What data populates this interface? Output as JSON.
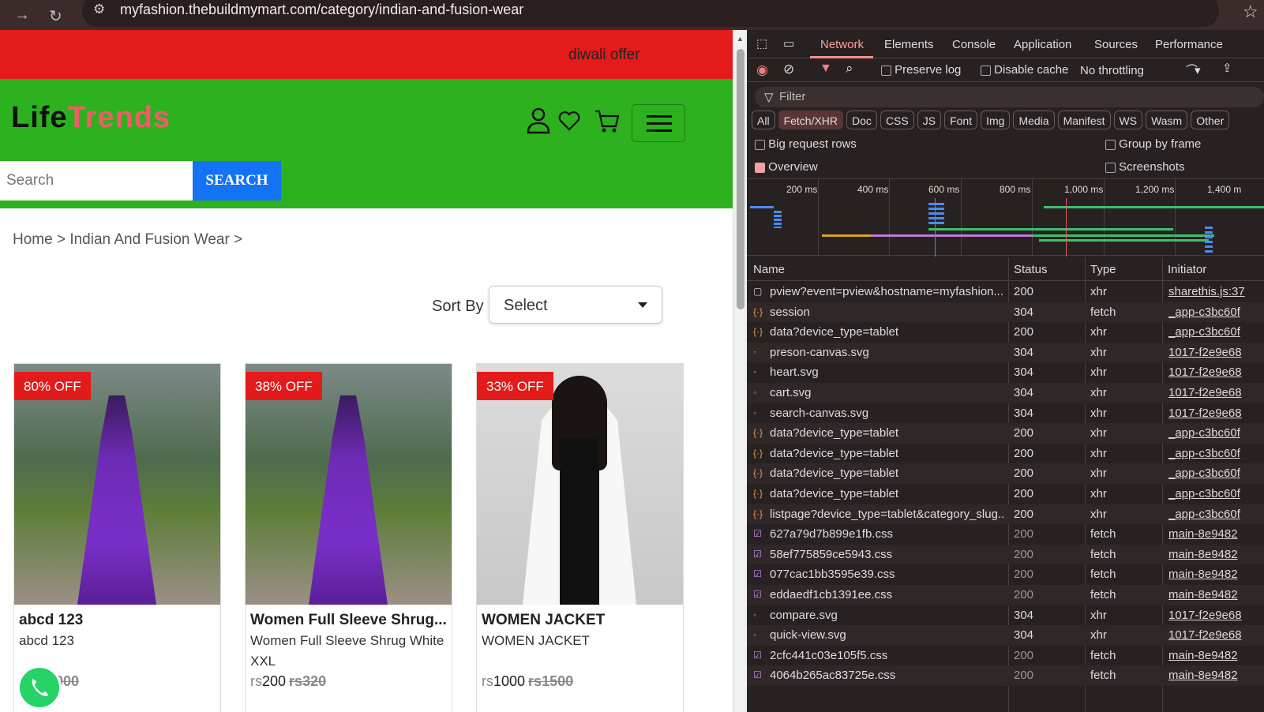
{
  "browser": {
    "url": "myfashion.thebuildmymart.com/category/indian-and-fusion-wear"
  },
  "site": {
    "offer_text": "diwali offer",
    "logo_part1": "Life",
    "logo_part2": "Trends",
    "search_placeholder": "Search",
    "search_button": "SEARCH",
    "breadcrumb": "Home > Indian And Fusion Wear >",
    "sort_label": "Sort By",
    "sort_value": "Select",
    "colors": {
      "offer_bar": "#e31b1b",
      "header": "#2db11f",
      "search_button": "#1472f5",
      "badge": "#e31b1b"
    },
    "products": [
      {
        "badge": "80% OFF",
        "title": "abcd 123",
        "subtitle": "abcd 123",
        "currency": "rs",
        "price": "",
        "old_price": "rs1000"
      },
      {
        "badge": "38% OFF",
        "title": "Women Full Sleeve Shrug...",
        "subtitle": "Women Full Sleeve Shrug White XXL",
        "currency": "rs",
        "price": "200",
        "old_price": "rs320"
      },
      {
        "badge": "33% OFF",
        "title": "WOMEN JACKET",
        "subtitle": "WOMEN JACKET",
        "currency": "rs",
        "price": "1000",
        "old_price": "rs1500"
      }
    ]
  },
  "devtools": {
    "tabs": [
      "Network",
      "Elements",
      "Console",
      "Application",
      "Sources",
      "Performance"
    ],
    "active_tab": "Network",
    "toolbar": {
      "preserve_log": "Preserve log",
      "disable_cache": "Disable cache",
      "throttling": "No throttling"
    },
    "filter_placeholder": "Filter",
    "chips": [
      "All",
      "Fetch/XHR",
      "Doc",
      "CSS",
      "JS",
      "Font",
      "Img",
      "Media",
      "Manifest",
      "WS",
      "Wasm",
      "Other"
    ],
    "selected_chip": "Fetch/XHR",
    "options": {
      "big_rows": "Big request rows",
      "overview": "Overview",
      "group_by_frame": "Group by frame",
      "screenshots": "Screenshots"
    },
    "timeline_labels": [
      "200 ms",
      "400 ms",
      "600 ms",
      "800 ms",
      "1,000 ms",
      "1,200 ms",
      "1,400 m"
    ],
    "columns": [
      "Name",
      "Status",
      "Type",
      "Initiator"
    ],
    "rows": [
      {
        "icon": "doc",
        "name": "pview?event=pview&hostname=myfashion....",
        "status": "200",
        "type": "xhr",
        "initiator": "sharethis.js:37"
      },
      {
        "icon": "xhr",
        "name": "session",
        "status": "304",
        "type": "fetch",
        "initiator": "_app-c3bc60f"
      },
      {
        "icon": "xhr",
        "name": "data?device_type=tablet",
        "status": "200",
        "type": "xhr",
        "initiator": "_app-c3bc60f"
      },
      {
        "icon": "img",
        "name": "preson-canvas.svg",
        "status": "304",
        "type": "xhr",
        "initiator": "1017-f2e9e68"
      },
      {
        "icon": "img",
        "name": "heart.svg",
        "status": "304",
        "type": "xhr",
        "initiator": "1017-f2e9e68"
      },
      {
        "icon": "img",
        "name": "cart.svg",
        "status": "304",
        "type": "xhr",
        "initiator": "1017-f2e9e68"
      },
      {
        "icon": "img",
        "name": "search-canvas.svg",
        "status": "304",
        "type": "xhr",
        "initiator": "1017-f2e9e68"
      },
      {
        "icon": "xhr",
        "name": "data?device_type=tablet",
        "status": "200",
        "type": "xhr",
        "initiator": "_app-c3bc60f"
      },
      {
        "icon": "xhr",
        "name": "data?device_type=tablet",
        "status": "200",
        "type": "xhr",
        "initiator": "_app-c3bc60f"
      },
      {
        "icon": "xhr",
        "name": "data?device_type=tablet",
        "status": "200",
        "type": "xhr",
        "initiator": "_app-c3bc60f"
      },
      {
        "icon": "xhr",
        "name": "data?device_type=tablet",
        "status": "200",
        "type": "xhr",
        "initiator": "_app-c3bc60f"
      },
      {
        "icon": "xhr",
        "name": "listpage?device_type=tablet&category_slug...",
        "status": "200",
        "type": "xhr",
        "initiator": "_app-c3bc60f"
      },
      {
        "icon": "css",
        "name": "627a79d7b899e1fb.css",
        "status": "200",
        "type": "fetch",
        "initiator": "main-8e9482"
      },
      {
        "icon": "css",
        "name": "58ef775859ce5943.css",
        "status": "200",
        "type": "fetch",
        "initiator": "main-8e9482"
      },
      {
        "icon": "css",
        "name": "077cac1bb3595e39.css",
        "status": "200",
        "type": "fetch",
        "initiator": "main-8e9482"
      },
      {
        "icon": "css",
        "name": "eddaedf1cb1391ee.css",
        "status": "200",
        "type": "fetch",
        "initiator": "main-8e9482"
      },
      {
        "icon": "img",
        "name": "compare.svg",
        "status": "304",
        "type": "xhr",
        "initiator": "1017-f2e9e68"
      },
      {
        "icon": "img",
        "name": "quick-view.svg",
        "status": "304",
        "type": "xhr",
        "initiator": "1017-f2e9e68"
      },
      {
        "icon": "css",
        "name": "2cfc441c03e105f5.css",
        "status": "200",
        "type": "fetch",
        "initiator": "main-8e9482"
      },
      {
        "icon": "css",
        "name": "4064b265ac83725e.css",
        "status": "200",
        "type": "fetch",
        "initiator": "main-8e9482"
      }
    ]
  }
}
